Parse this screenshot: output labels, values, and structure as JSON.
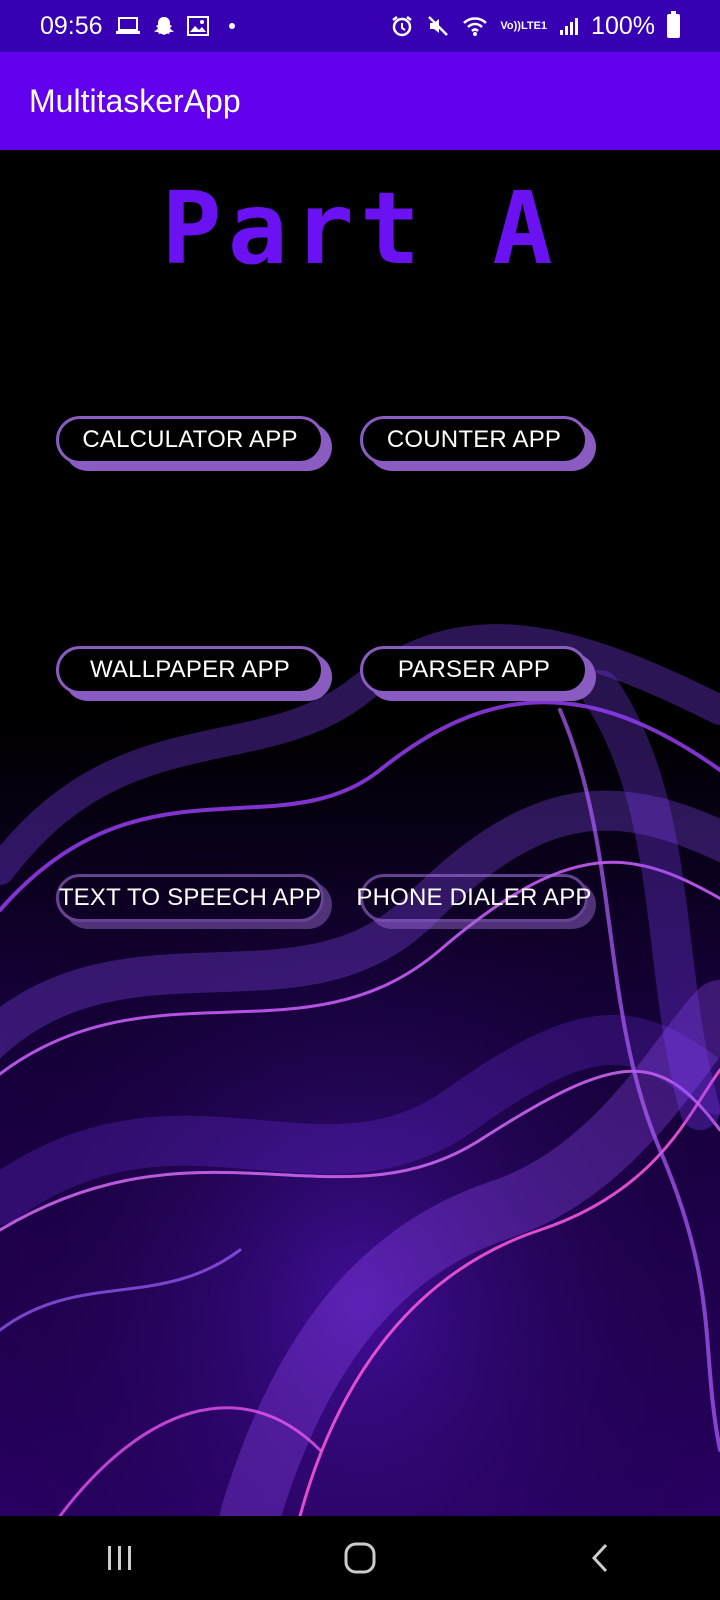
{
  "status_bar": {
    "time": "09:56",
    "left_icons": [
      "laptop-icon",
      "snapchat-icon",
      "gallery-icon",
      "dot-icon"
    ],
    "right_icons": [
      "alarm-icon",
      "mute-icon",
      "wifi-icon",
      "volte-lte-icon",
      "signal-icon",
      "battery-icon"
    ],
    "volte_label": "Vo))",
    "lte_label": "LTE1",
    "battery": "100%"
  },
  "app_bar": {
    "title": "MultitaskerApp"
  },
  "main": {
    "heading": "Part A",
    "buttons": [
      {
        "label": "CALCULATOR APP"
      },
      {
        "label": "COUNTER APP"
      },
      {
        "label": "WALLPAPER  APP"
      },
      {
        "label": "PARSER APP"
      },
      {
        "label": "TEXT TO SPEECH APP"
      },
      {
        "label": "PHONE DIALER APP"
      }
    ],
    "background": "purple-wave-wallpaper"
  },
  "nav_bar": {
    "buttons": [
      "recents-icon",
      "home-icon",
      "back-icon"
    ]
  },
  "colors": {
    "status_bar": "#3700b3",
    "app_bar": "#6200ee",
    "heading": "#6a12f2",
    "button_border": "#8a5bc0"
  }
}
